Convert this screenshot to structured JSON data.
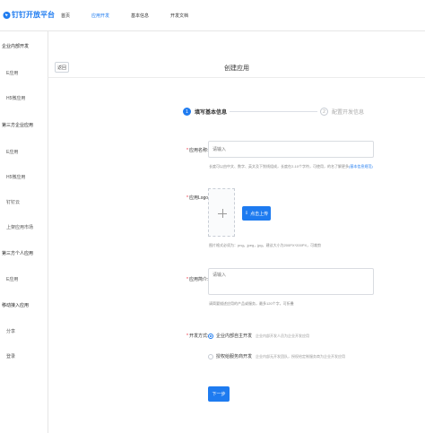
{
  "app": {
    "logo_text": "钉钉开放平台",
    "brand_color": "#1e7bf0"
  },
  "topnav": [
    "首页",
    "应用开发",
    "基本信息",
    "开发文档"
  ],
  "topnav_active": 1,
  "sidebar": {
    "g1": "企业内部开发",
    "g1_i1": "E应用",
    "g1_i2": "H5微应用",
    "g2": "第三方企业应用",
    "g2_i1": "E应用",
    "g2_i2": "H5微应用",
    "g2_i3": "钉钉云",
    "g2_i4": "上架应用市场",
    "g3": "第三方个人应用",
    "g3_i1": "E应用",
    "g4": "移动接入应用",
    "g4_i1": "分享",
    "g4_i2": "登录"
  },
  "header": {
    "back_label": "返回",
    "title": "创建应用"
  },
  "steps": [
    {
      "number": "1",
      "label": "填写基本信息"
    },
    {
      "number": "2",
      "label": "配置开发信息"
    }
  ],
  "form": {
    "name_label": "应用名称:",
    "name_placeholder": "请输入",
    "name_hint": "长度可以由中文、数字、英文及下划线组成，长度在2-10个字符，可使用，的名了解更多",
    "name_hint_link": "(基本信息规范)",
    "logo_label": "应用Logo:",
    "upload_label": "点击上传",
    "logo_hint": "图片格式必须为：png，jpeg，jpg，建议大小为200PX*200PX，可裁剪",
    "intro_label": "应用简介:",
    "intro_placeholder": "请输入",
    "intro_hint": "请简要描述应用的产品或服务，最多120个字，可折叠",
    "mode_label": "开发方式:",
    "mode_options": [
      {
        "label": "企业内部自主开发",
        "desc": "企业内部开发人员为企业开发应用",
        "selected": true
      },
      {
        "label": "授权给服务商开发",
        "desc": "企业内部无开发团队，授权给定制服务商为企业开发应用",
        "selected": false
      }
    ],
    "next_label": "下一步"
  }
}
